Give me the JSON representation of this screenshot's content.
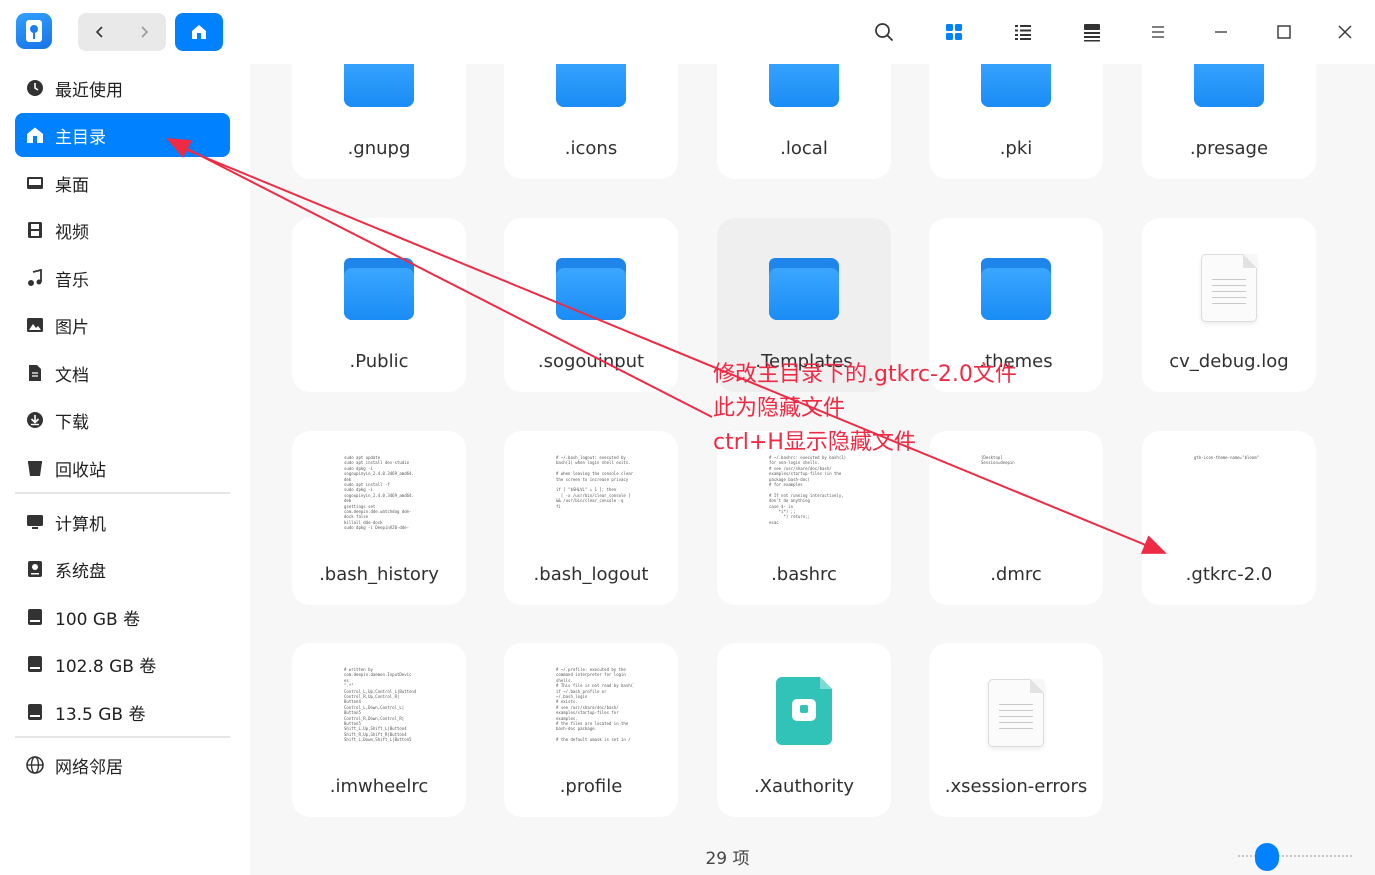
{
  "titlebar": {
    "icons": {
      "app": "file-manager-logo",
      "back": "chevron-left-icon",
      "forward": "chevron-right-icon",
      "home": "home-icon",
      "search": "search-icon",
      "icon_view": "grid-view-icon",
      "list_view": "list-view-icon",
      "detail_view": "detail-view-icon",
      "menu": "menu-icon",
      "minimize": "minimize-icon",
      "maximize": "maximize-icon",
      "close": "close-icon"
    },
    "accent": "#0081ff"
  },
  "sidebar": {
    "items": [
      {
        "label": "最近使用",
        "icon": "clock-icon"
      },
      {
        "label": "主目录",
        "icon": "home-icon",
        "active": true
      },
      {
        "label": "桌面",
        "icon": "desktop-icon"
      },
      {
        "label": "视频",
        "icon": "video-icon"
      },
      {
        "label": "音乐",
        "icon": "music-icon"
      },
      {
        "label": "图片",
        "icon": "picture-icon"
      },
      {
        "label": "文档",
        "icon": "document-icon"
      },
      {
        "label": "下载",
        "icon": "download-icon"
      },
      {
        "label": "回收站",
        "icon": "trash-icon"
      },
      {
        "label": "计算机",
        "icon": "computer-icon"
      },
      {
        "label": "系统盘",
        "icon": "system-disk-icon"
      },
      {
        "label": "100 GB 卷",
        "icon": "disk-icon"
      },
      {
        "label": "102.8 GB 卷",
        "icon": "disk-icon"
      },
      {
        "label": "13.5 GB 卷",
        "icon": "disk-icon"
      },
      {
        "label": "网络邻居",
        "icon": "network-icon"
      }
    ]
  },
  "files": [
    {
      "name": ".gnupg",
      "kind": "folder"
    },
    {
      "name": ".icons",
      "kind": "folder"
    },
    {
      "name": ".local",
      "kind": "folder"
    },
    {
      "name": ".pki",
      "kind": "folder"
    },
    {
      "name": ".presage",
      "kind": "folder"
    },
    {
      "name": ".Public",
      "kind": "folder"
    },
    {
      "name": ".sogouinput",
      "kind": "folder"
    },
    {
      "name": ".Templates",
      "kind": "folder"
    },
    {
      "name": ".themes",
      "kind": "folder"
    },
    {
      "name": "cv_debug.log",
      "kind": "document"
    },
    {
      "name": ".bash_history",
      "kind": "text",
      "preview": "sudo apt update\nsudo apt install dev-studio\nsudo dpkg -i\nsogoupinyin_2.4.0.3469_amd64.\ndeb\nsudo apt install -f\nsudo dpkg -i\nsogoupinyin_2.4.0.3469_amd64.\ndeb\ngsettings set\ncom.deepin.dde.watchdog dde-\ndock false\nkillall dde-dock\nsudo dpkg -i DeepinV20-dde-"
    },
    {
      "name": ".bash_logout",
      "kind": "text",
      "preview": "# ~/.bash_logout: executed by\nbash(1) when login shell exits.\n\n# when leaving the console clear\nthe screen to increase privacy\n\nif [ \"$SHLVL\" = 1 ]; then\n  [ -x /usr/bin/clear_console ]\n&& /usr/bin/clear_console -q\nfi"
    },
    {
      "name": ".bashrc",
      "kind": "text",
      "preview": "# ~/.bashrc: executed by bash(1)\nfor non-login shells.\n# see /usr/share/doc/bash/\nexamples/startup-files (in the\npackage bash-doc)\n# for examples\n\n# If not running interactively,\ndon't do anything\ncase $- in\n    *i*) ;;\n      *) return;;\nesac"
    },
    {
      "name": ".dmrc",
      "kind": "text",
      "preview": "[Desktop]\nSession=deepin"
    },
    {
      "name": ".gtkrc-2.0",
      "kind": "text",
      "preview": "gtk-icon-theme-name=\"bloom\""
    },
    {
      "name": ".imwheelrc",
      "kind": "text",
      "preview": "# written by\ncom.deepin.daemon.InputDevic\nes\n\".*\"\nControl_L,Up,Control_L|Button4\nControl_R,Up,Control_R|\nButton4\nControl_L,Down,Control_L|\nButton5\nControl_R,Down,Control_R|\nButton5\nShift_L,Up,Shift_L|Button4\nShift_R,Up,Shift_R|Button4\nShift_L,Down,Shift_L|Button5"
    },
    {
      "name": ".profile",
      "kind": "text",
      "preview": "# ~/.profile: executed by the\ncommand interpreter for login\nshells.\n# This file is not read by bash(1),\nif ~/.bash_profile or\n~/.bash_login\n# exists.\n# see /usr/share/doc/bash/\nexamples/startup-files for\nexamples.\n# the files are located in the\nbash-doc package.\n\n# the default umask is set in /"
    },
    {
      "name": ".Xauthority",
      "kind": "xauthority"
    },
    {
      "name": ".xsession-errors",
      "kind": "document"
    }
  ],
  "status": {
    "item_count": "29 项"
  },
  "annotation": {
    "lines": [
      "修改主目录下的.gtkrc-2.0文件",
      "此为隐藏文件",
      "ctrl+H显示隐藏文件"
    ],
    "color": "#ee2b45"
  }
}
